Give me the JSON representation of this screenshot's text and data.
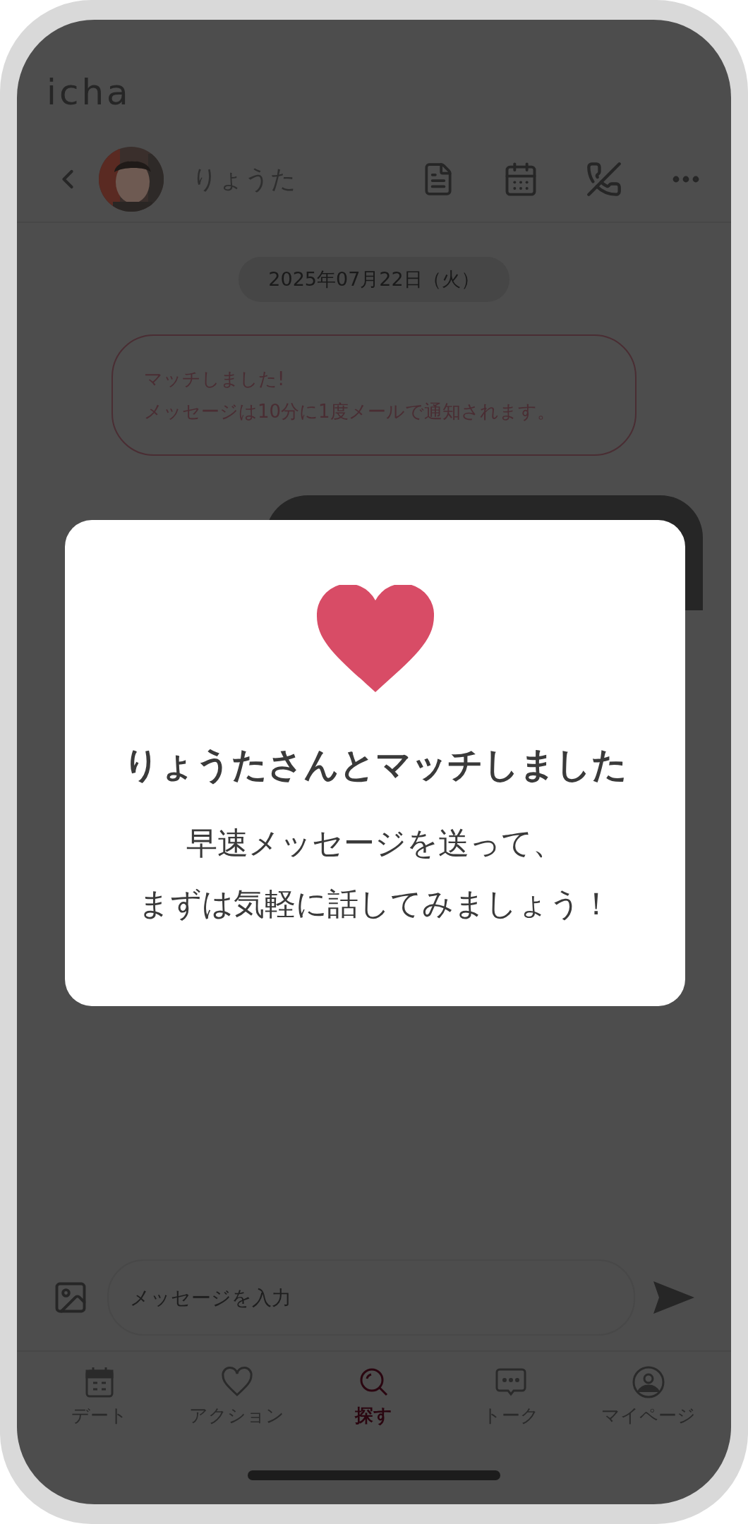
{
  "app": {
    "logo": "icha"
  },
  "header": {
    "name": "りょうた"
  },
  "chat": {
    "date": "2025年07月22日（火）",
    "system_message": [
      "マッチしました!",
      "メッセージは10分に1度メールで通知されます。"
    ]
  },
  "modal": {
    "title": "りょうたさんとマッチしました",
    "body": [
      "早速メッセージを送って、",
      "まずは気軽に話してみましょう！"
    ]
  },
  "composer": {
    "placeholder": "メッセージを入力"
  },
  "nav": [
    {
      "label": "デート",
      "kind": "calendar",
      "selected": false
    },
    {
      "label": "アクション",
      "kind": "heart",
      "selected": false
    },
    {
      "label": "探す",
      "kind": "search",
      "selected": true
    },
    {
      "label": "トーク",
      "kind": "chat",
      "selected": false
    },
    {
      "label": "マイページ",
      "kind": "user",
      "selected": false
    }
  ]
}
